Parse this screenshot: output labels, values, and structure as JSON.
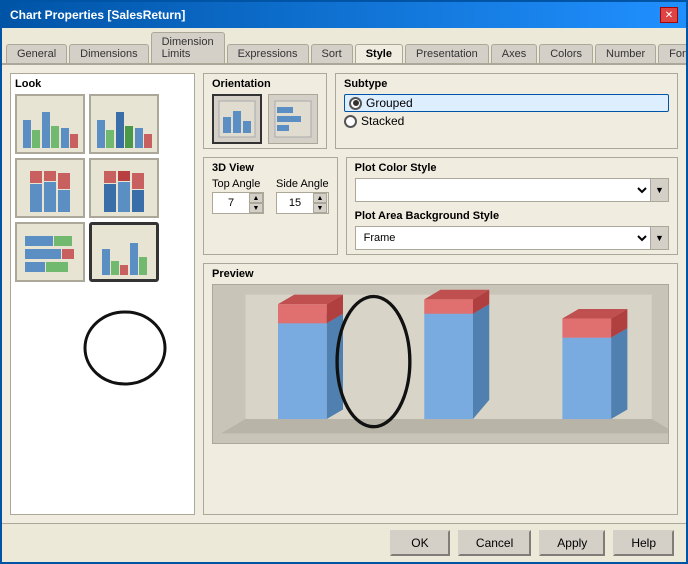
{
  "window": {
    "title": "Chart Properties [SalesReturn]",
    "close_btn": "✕"
  },
  "tabs": {
    "items": [
      "General",
      "Dimensions",
      "Dimension Limits",
      "Expressions",
      "Sort",
      "Style",
      "Presentation",
      "Axes",
      "Colors",
      "Number",
      "Font"
    ],
    "active": "Style",
    "nav_prev": "◄",
    "nav_next": "►"
  },
  "look": {
    "label": "Look"
  },
  "orientation": {
    "label": "Orientation"
  },
  "subtype": {
    "label": "Subtype",
    "options": [
      "Grouped",
      "Stacked"
    ],
    "selected": "Grouped"
  },
  "view3d": {
    "label": "3D View",
    "top_angle_label": "Top Angle",
    "side_angle_label": "Side Angle",
    "top_angle_value": "7",
    "side_angle_value": "15"
  },
  "plot_color": {
    "label": "Plot Color Style",
    "value": ""
  },
  "plot_bg": {
    "label": "Plot Area Background Style",
    "value": "Frame"
  },
  "preview": {
    "label": "Preview"
  },
  "buttons": {
    "ok": "OK",
    "cancel": "Cancel",
    "apply": "Apply",
    "help": "Help"
  }
}
